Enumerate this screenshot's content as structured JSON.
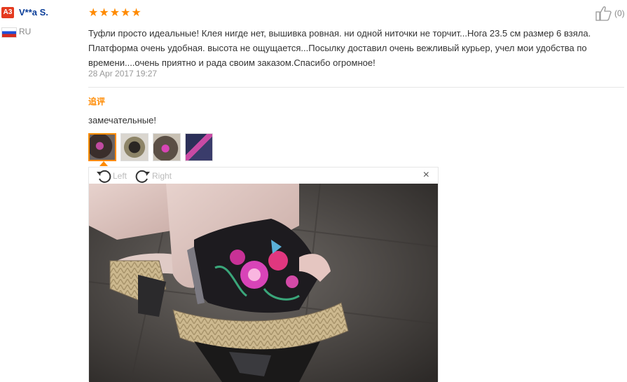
{
  "user": {
    "level_badge": "A3",
    "name": "V**a S.",
    "country": "RU"
  },
  "review": {
    "stars": "★★★★★",
    "like_count": "(0)",
    "text": "Туфли просто идеальные! Клея нигде нет, вышивка ровная. ни одной ниточки не торчит...Нога 23.5 см размер 6 взяла. Платформа очень удобная. высота не ощущается...Посылку доставил очень вежливый курьер, учел мои удобства по времени....очень приятно и рада своим заказом.Спасибо огромное!",
    "date": "28 Apr 2017 19:27"
  },
  "additional": {
    "title": "追评",
    "text": "замечательные!"
  },
  "viewer": {
    "rotate_left": "Left",
    "rotate_right": "Right",
    "close": "×"
  },
  "colors": {
    "accent": "#ff8a00",
    "badge": "#e43a1f",
    "username": "#0b3e99"
  }
}
